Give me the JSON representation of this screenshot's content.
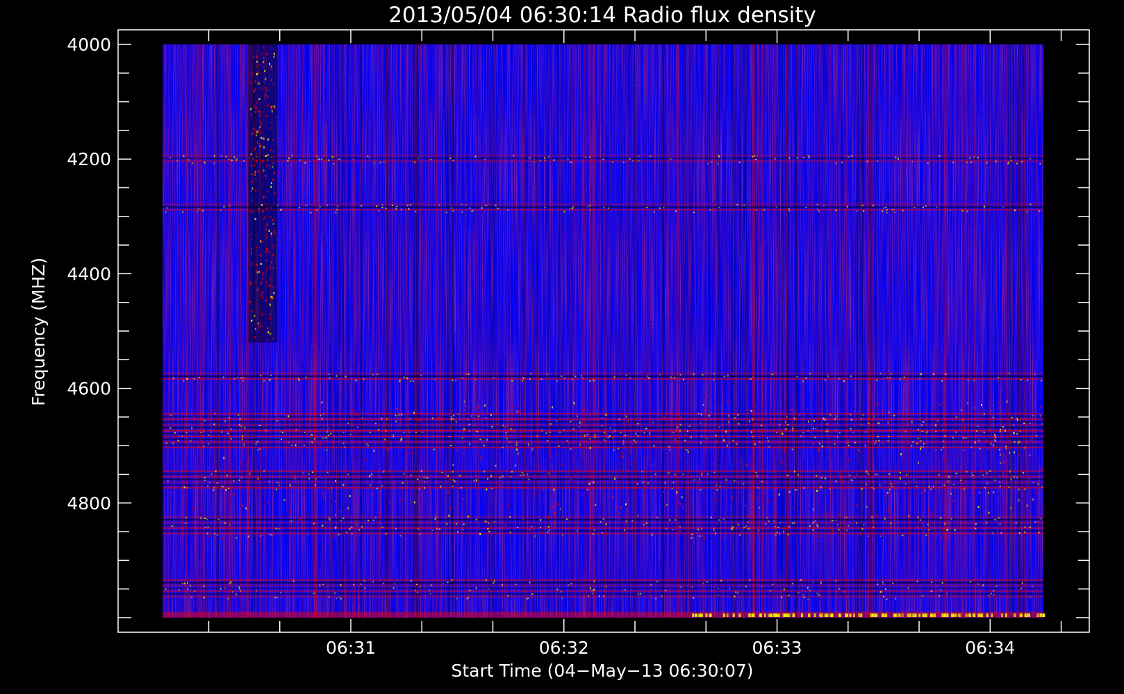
{
  "chart_data": {
    "type": "heatmap",
    "title": "2013/05/04 06:30:14 Radio flux density",
    "xlabel": "Start Time (04−May−13 06:30:07)",
    "ylabel": "Frequency (MHZ)",
    "x_ticks": [
      "06:31",
      "06:32",
      "06:33",
      "06:34"
    ],
    "y_ticks": [
      "4000",
      "4200",
      "4400",
      "4600",
      "4800"
    ],
    "x_range": [
      "06:30:07",
      "06:34:15"
    ],
    "y_range": [
      4000,
      5000
    ],
    "y_inverted": true,
    "grid": false,
    "colormap": [
      "#000000",
      "#0000ff",
      "#ff0000",
      "#ffff00"
    ],
    "background_color": "#000000",
    "frame_color": "#ffffff",
    "features": {
      "horizontal_bands_mhz": [
        4200,
        4285,
        4580,
        4660,
        4690,
        4760,
        4840,
        4950
      ],
      "burst_time": "06:30:35",
      "burst_freq_range_mhz": [
        4000,
        4520
      ],
      "bright_edge_freq_mhz": 4990
    }
  }
}
